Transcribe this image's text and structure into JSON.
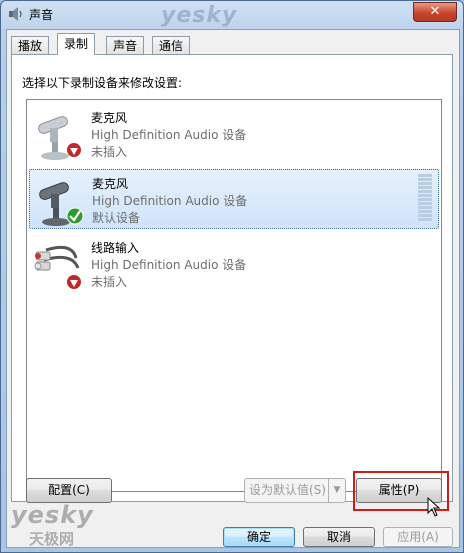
{
  "window": {
    "title": "声音",
    "close_glyph": "✕",
    "watermark": "yesky"
  },
  "tabs": [
    {
      "label": "播放"
    },
    {
      "label": "录制",
      "active": true
    },
    {
      "label": "声音"
    },
    {
      "label": "通信"
    }
  ],
  "instruction": "选择以下录制设备来修改设置:",
  "devices": [
    {
      "name": "麦克风",
      "desc": "High Definition Audio 设备",
      "status": "未插入",
      "icon": "microphone-icon",
      "badge": "unplugged-icon"
    },
    {
      "name": "麦克风",
      "desc": "High Definition Audio 设备",
      "status": "默认设备",
      "icon": "microphone-icon",
      "badge": "default-check-icon",
      "selected": true
    },
    {
      "name": "线路输入",
      "desc": "High Definition Audio 设备",
      "status": "未插入",
      "icon": "line-in-icon",
      "badge": "unplugged-icon"
    }
  ],
  "buttons": {
    "configure": "配置(C)",
    "set_default": "设为默认值(S)",
    "properties": "属性(P)",
    "ok": "确定",
    "cancel": "取消",
    "apply": "应用(A)"
  },
  "watermark_bottom": {
    "text": "yesky",
    "sub": "天极网"
  },
  "colors": {
    "accent": "#3c7fb1",
    "highlight": "#d11a1a",
    "selection": "#cfe4fa"
  }
}
